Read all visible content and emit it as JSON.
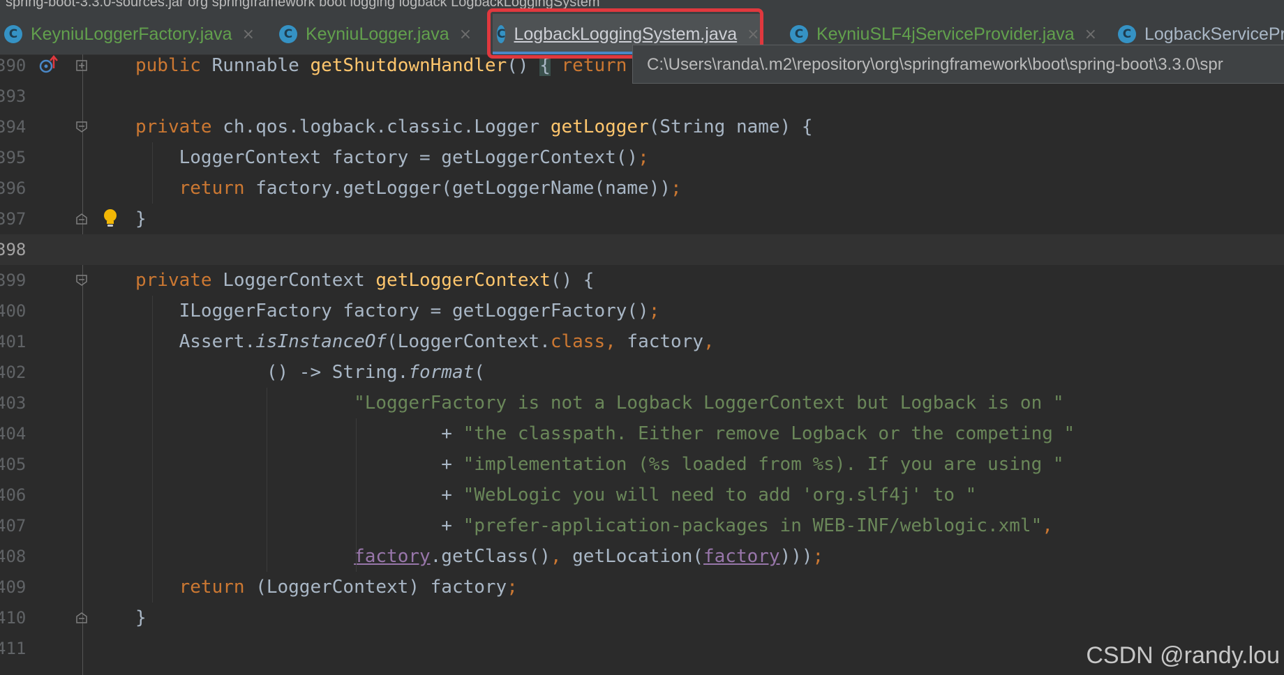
{
  "breadcrumb": {
    "text": "spring-boot-3.3.0-sources.jar  org  springframework  boot  logging  logback  LogbackLoggingSystem"
  },
  "tabs": [
    {
      "label": "KeyniuLoggerFactory.java",
      "icon": "C",
      "close": "×",
      "active": false
    },
    {
      "label": "KeyniuLogger.java",
      "icon": "C",
      "close": "×",
      "active": false
    },
    {
      "label": "LogbackLoggingSystem.java",
      "icon": "C",
      "close": "×",
      "active": true
    },
    {
      "label": "KeyniuSLF4jServiceProvider.java",
      "icon": "C",
      "close": "×",
      "active": false
    },
    {
      "label": "LogbackServicePr",
      "icon": "C",
      "close": "",
      "active": false
    }
  ],
  "tooltip": {
    "text": "C:\\Users\\randa\\.m2\\repository\\org\\springframework\\boot\\spring-boot\\3.3.0\\spr"
  },
  "editor": {
    "lines": [
      {
        "num": "390",
        "tokens": [
          [
            "kw",
            "public "
          ],
          [
            "dim",
            "Runnable "
          ],
          [
            "fn",
            "getShutdownHandler"
          ],
          [
            "dim",
            "() "
          ],
          [
            "paren",
            "{"
          ],
          [
            "kw",
            " return"
          ]
        ]
      },
      {
        "num": "393",
        "tokens": []
      },
      {
        "num": "394",
        "tokens": [
          [
            "kw",
            "private "
          ],
          [
            "dim",
            "ch.qos.logback.classic.Logger "
          ],
          [
            "fn",
            "getLogger"
          ],
          [
            "dim",
            "(String name) {"
          ]
        ]
      },
      {
        "num": "395",
        "tokens": [
          [
            "dim",
            "    LoggerContext factory = getLoggerContext()"
          ],
          [
            "kw",
            ";"
          ]
        ]
      },
      {
        "num": "396",
        "tokens": [
          [
            "kw",
            "    return "
          ],
          [
            "dim",
            "factory.getLogger(getLoggerName(name))"
          ],
          [
            "kw",
            ";"
          ]
        ]
      },
      {
        "num": "397",
        "tokens": [
          [
            "dim",
            "}"
          ]
        ]
      },
      {
        "num": "398",
        "tokens": []
      },
      {
        "num": "399",
        "tokens": [
          [
            "kw",
            "private "
          ],
          [
            "dim",
            "LoggerContext "
          ],
          [
            "fn",
            "getLoggerContext"
          ],
          [
            "dim",
            "() {"
          ]
        ]
      },
      {
        "num": "400",
        "tokens": [
          [
            "dim",
            "    ILoggerFactory factory = getLoggerFactory()"
          ],
          [
            "kw",
            ";"
          ]
        ]
      },
      {
        "num": "401",
        "tokens": [
          [
            "dim",
            "    Assert."
          ],
          [
            "it",
            "isInstanceOf"
          ],
          [
            "dim",
            "(LoggerContext."
          ],
          [
            "kw",
            "class, "
          ],
          [
            "dim",
            "factory"
          ],
          [
            "kw",
            ","
          ]
        ]
      },
      {
        "num": "402",
        "tokens": [
          [
            "dim",
            "            () -> String."
          ],
          [
            "it",
            "format"
          ],
          [
            "dim",
            "("
          ]
        ]
      },
      {
        "num": "403",
        "tokens": [
          [
            "str",
            "                    \"LoggerFactory is not a Logback LoggerContext but Logback is on \""
          ]
        ]
      },
      {
        "num": "404",
        "tokens": [
          [
            "dim",
            "                            + "
          ],
          [
            "str",
            "\"the classpath. Either remove Logback or the competing \""
          ]
        ]
      },
      {
        "num": "405",
        "tokens": [
          [
            "dim",
            "                            + "
          ],
          [
            "str",
            "\"implementation (%s loaded from %s). If you are using \""
          ]
        ]
      },
      {
        "num": "406",
        "tokens": [
          [
            "dim",
            "                            + "
          ],
          [
            "str",
            "\"WebLogic you will need to add 'org.slf4j' to \""
          ]
        ]
      },
      {
        "num": "407",
        "tokens": [
          [
            "dim",
            "                            + "
          ],
          [
            "str",
            "\"prefer-application-packages in WEB-INF/weblogic.xml\""
          ],
          [
            "kw",
            ","
          ]
        ]
      },
      {
        "num": "408",
        "tokens": [
          [
            "dim",
            "                    "
          ],
          [
            "und",
            "factory"
          ],
          [
            "dim",
            ".getClass()"
          ],
          [
            "kw",
            ", "
          ],
          [
            "dim",
            "getLocation("
          ],
          [
            "und",
            "factory"
          ],
          [
            "dim",
            ")))"
          ],
          [
            "kw",
            ";"
          ]
        ]
      },
      {
        "num": "409",
        "tokens": [
          [
            "kw",
            "    return "
          ],
          [
            "dim",
            "(LoggerContext) factory"
          ],
          [
            "kw",
            ";"
          ]
        ]
      },
      {
        "num": "410",
        "tokens": [
          [
            "dim",
            "}"
          ]
        ]
      },
      {
        "num": "411",
        "tokens": []
      }
    ]
  },
  "watermark": {
    "text": "CSDN @randy.lou"
  },
  "colors": {
    "keyword": "#cc7832",
    "function": "#ffc66d",
    "string": "#6a8759",
    "highlight": "#e0383e",
    "accent": "#4a88c7"
  }
}
